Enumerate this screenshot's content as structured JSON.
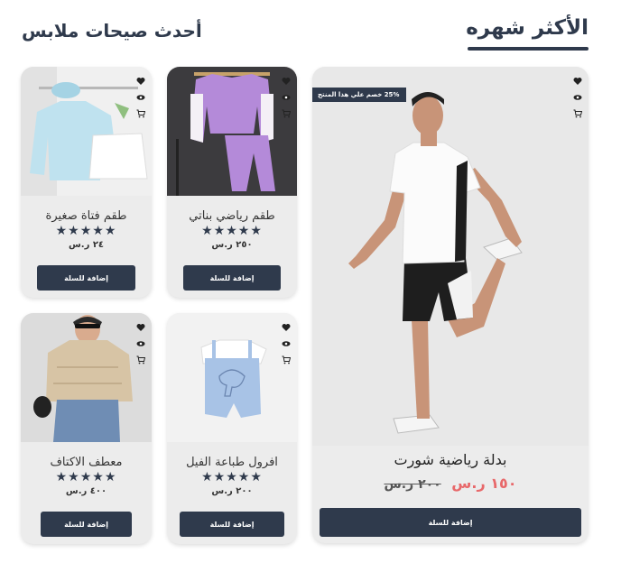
{
  "sections": {
    "most_of_month": "الأكثر شهره",
    "latest_clothes": "أحدث صيحات ملابس"
  },
  "featured": {
    "badge": "25% خصم علي هذا المنتج",
    "name": "بدلة رياضية شورت",
    "price_new": "١٥٠ ر.س",
    "price_old": "٢٠٠ ر.س",
    "button": "إضافة للسلة"
  },
  "products": [
    {
      "name": "طقم رياضي بناتي",
      "stars": "★★★★★",
      "price": "٢٥٠ ر.س",
      "button": "إضافة للسلة"
    },
    {
      "name": "طقم فتاة صغيرة",
      "stars": "★★★★★",
      "price": "٢٤ ر.س",
      "button": "إضافة للسلة"
    },
    {
      "name": "افرول طباعة الفيل",
      "stars": "★★★★★",
      "price": "٢٠٠ ر.س",
      "button": "إضافة للسلة"
    },
    {
      "name": "معطف الاكتاف",
      "stars": "★★★★★",
      "price": "٤٠٠ ر.س",
      "button": "إضافة للسلة"
    }
  ],
  "colors": {
    "primary": "#2f3a4c",
    "sale": "#e8686a",
    "card": "#ececec"
  },
  "icons": [
    "heart-icon",
    "eye-icon",
    "cart-icon"
  ]
}
